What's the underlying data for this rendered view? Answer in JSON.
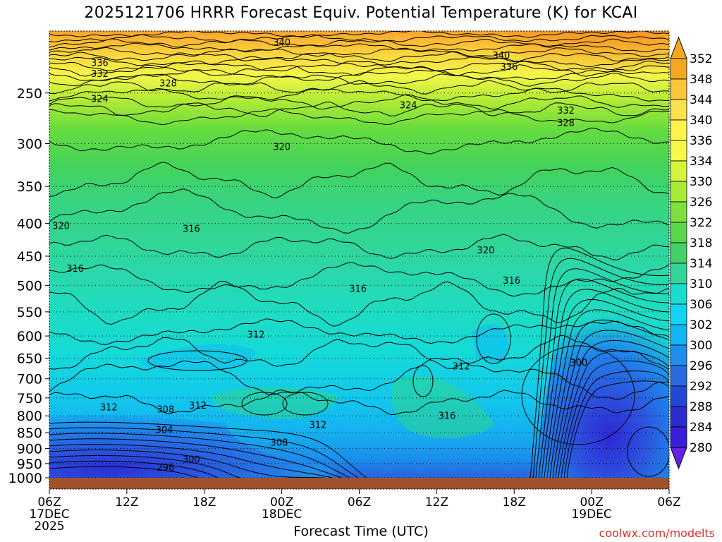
{
  "title": "2025121706 HRRR Forecast Equiv. Potential Temperature (K) for KCAI",
  "xlabel": "Forecast Time (UTC)",
  "credit": "coolwx.com/modelts",
  "chart_data": {
    "type": "heatmap",
    "title": "2025121706 HRRR Forecast Equiv. Potential Temperature (K) for KCAI",
    "xlabel": "Forecast Time (UTC)",
    "ylabel": "",
    "y_scale": "log-pressure",
    "y_reversed": true,
    "ylim": [
      1000,
      200
    ],
    "xlim": [
      0,
      48
    ],
    "x_hours": [
      0,
      6,
      12,
      18,
      24,
      30,
      36,
      42,
      48
    ],
    "x_tick_labels": [
      {
        "hour": 0,
        "lines": [
          "06Z",
          "17DEC",
          "2025"
        ]
      },
      {
        "hour": 6,
        "lines": [
          "12Z"
        ]
      },
      {
        "hour": 12,
        "lines": [
          "18Z"
        ]
      },
      {
        "hour": 18,
        "lines": [
          "00Z",
          "18DEC"
        ]
      },
      {
        "hour": 24,
        "lines": [
          "06Z"
        ]
      },
      {
        "hour": 30,
        "lines": [
          "12Z"
        ]
      },
      {
        "hour": 36,
        "lines": [
          "18Z"
        ]
      },
      {
        "hour": 42,
        "lines": [
          "00Z",
          "19DEC"
        ]
      },
      {
        "hour": 48,
        "lines": [
          "06Z"
        ]
      }
    ],
    "y_ticks": [
      250,
      300,
      350,
      400,
      450,
      500,
      550,
      600,
      650,
      700,
      750,
      800,
      850,
      900,
      950,
      1000
    ],
    "y_tick_labels": [
      "250",
      "300",
      "350",
      "400",
      "450",
      "500",
      "550",
      "600",
      "650",
      "700",
      "750",
      "800",
      "850",
      "900",
      "950",
      "1000"
    ],
    "grid": "dotted horizontal at pressure levels",
    "colorbar": {
      "placement": "right",
      "labels": [
        "352",
        "348",
        "344",
        "340",
        "336",
        "334",
        "330",
        "326",
        "322",
        "318",
        "314",
        "310",
        "306",
        "302",
        "300",
        "296",
        "292",
        "288",
        "284",
        "280"
      ],
      "colors": [
        "#f4a820",
        "#f7c63a",
        "#fbe14c",
        "#fff34e",
        "#f6f84a",
        "#d4f43a",
        "#a7ea33",
        "#7ee03c",
        "#5ad64d",
        "#44cf67",
        "#33d39a",
        "#19dccd",
        "#0fd5f2",
        "#13b6f5",
        "#1e8fed",
        "#2a6ae0",
        "#2448d6",
        "#2a2ccf",
        "#3a1fd8",
        "#6322e6"
      ]
    },
    "contour_interval": 2,
    "contour_labels": [
      {
        "value": "340",
        "hour": 18.0,
        "p": 208
      },
      {
        "value": "340",
        "hour": 35.0,
        "p": 218
      },
      {
        "value": "336",
        "hour": 3.9,
        "p": 224
      },
      {
        "value": "336",
        "hour": 35.6,
        "p": 227
      },
      {
        "value": "332",
        "hour": 3.9,
        "p": 233
      },
      {
        "value": "328",
        "hour": 9.2,
        "p": 241
      },
      {
        "value": "324",
        "hour": 3.9,
        "p": 255
      },
      {
        "value": "324",
        "hour": 27.8,
        "p": 261
      },
      {
        "value": "332",
        "hour": 40.0,
        "p": 266
      },
      {
        "value": "328",
        "hour": 40.0,
        "p": 278
      },
      {
        "value": "320",
        "hour": 18.0,
        "p": 303
      },
      {
        "value": "320",
        "hour": 0.9,
        "p": 403
      },
      {
        "value": "316",
        "hour": 11.0,
        "p": 407
      },
      {
        "value": "320",
        "hour": 33.8,
        "p": 440
      },
      {
        "value": "316",
        "hour": 2.0,
        "p": 470
      },
      {
        "value": "316",
        "hour": 35.8,
        "p": 491
      },
      {
        "value": "316",
        "hour": 23.9,
        "p": 505
      },
      {
        "value": "312",
        "hour": 16.0,
        "p": 596
      },
      {
        "value": "312",
        "hour": 31.9,
        "p": 668
      },
      {
        "value": "300",
        "hour": 41.0,
        "p": 660
      },
      {
        "value": "312",
        "hour": 4.6,
        "p": 775
      },
      {
        "value": "308",
        "hour": 9.0,
        "p": 780
      },
      {
        "value": "312",
        "hour": 11.5,
        "p": 770
      },
      {
        "value": "316",
        "hour": 30.8,
        "p": 799
      },
      {
        "value": "312",
        "hour": 20.8,
        "p": 825
      },
      {
        "value": "304",
        "hour": 8.9,
        "p": 840
      },
      {
        "value": "308",
        "hour": 17.8,
        "p": 880
      },
      {
        "value": "300",
        "hour": 11.0,
        "p": 935
      },
      {
        "value": "296",
        "hour": 9.0,
        "p": 962
      }
    ]
  }
}
